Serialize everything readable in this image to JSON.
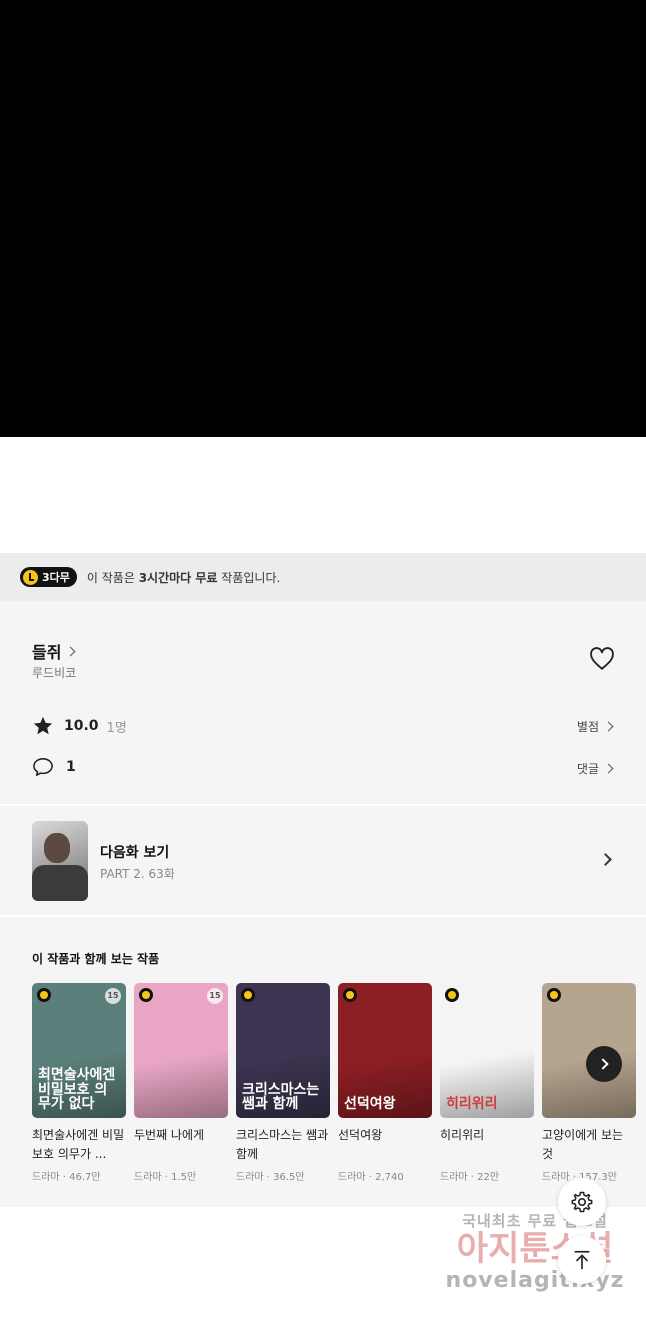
{
  "notice": {
    "badge": "3다무",
    "prefix": "이 작품은 ",
    "highlight": "3시간마다 무료",
    "suffix": " 작품입니다."
  },
  "work": {
    "title": "들쥐",
    "author": "루드비코",
    "rating": "10.0",
    "rating_count": "1명",
    "rating_link": "별점",
    "comments": "1",
    "comments_link": "댓글"
  },
  "next_episode": {
    "label": "다음화 보기",
    "sub": "PART 2. 63화"
  },
  "recommend": {
    "heading": "이 작품과 함께 보는 작품",
    "items": [
      {
        "title": "최면술사에겐 비밀보호 의무가 ...",
        "meta": "드라마 · 46.7만",
        "age": "15",
        "cover_text": "최면술사에겐 비밀보호 의무가 없다",
        "bg": "#5b7f7a",
        "fg": "#ffffff"
      },
      {
        "title": "두번째 나에게",
        "meta": "드라마 · 1.5만",
        "age": "15",
        "cover_text": "",
        "bg": "#e8a6c4",
        "fg": "#ffffff"
      },
      {
        "title": "크리스마스는 쌤과 함께",
        "meta": "드라마 · 36.5만",
        "age": "",
        "cover_text": "크리스마스는 쌤과 함께",
        "bg": "#3c3450",
        "fg": "#ffffff"
      },
      {
        "title": "선덕여왕",
        "meta": "드라마 · 2,740",
        "age": "",
        "cover_text": "선덕여왕",
        "bg": "#8c1f24",
        "fg": "#ffffff"
      },
      {
        "title": "히리위리",
        "meta": "드라마 · 22만",
        "age": "",
        "cover_text": "히리위리",
        "bg": "#f4f4f4",
        "fg": "#d13b3b"
      },
      {
        "title": "고양이에게 보는 것",
        "meta": "드라마 · 157.3만",
        "age": "",
        "cover_text": "",
        "bg": "#b5a48e",
        "fg": "#ffffff"
      }
    ]
  },
  "icons": {
    "heart": "heart-icon",
    "star": "star-icon",
    "comment": "comment-icon",
    "settings": "gear-icon",
    "scroll_top": "arrow-up-icon"
  },
  "watermark": {
    "line1": "국내최초 무료 웹소설",
    "line2": "아지툰소설",
    "line3": "novelagit.xyz"
  }
}
